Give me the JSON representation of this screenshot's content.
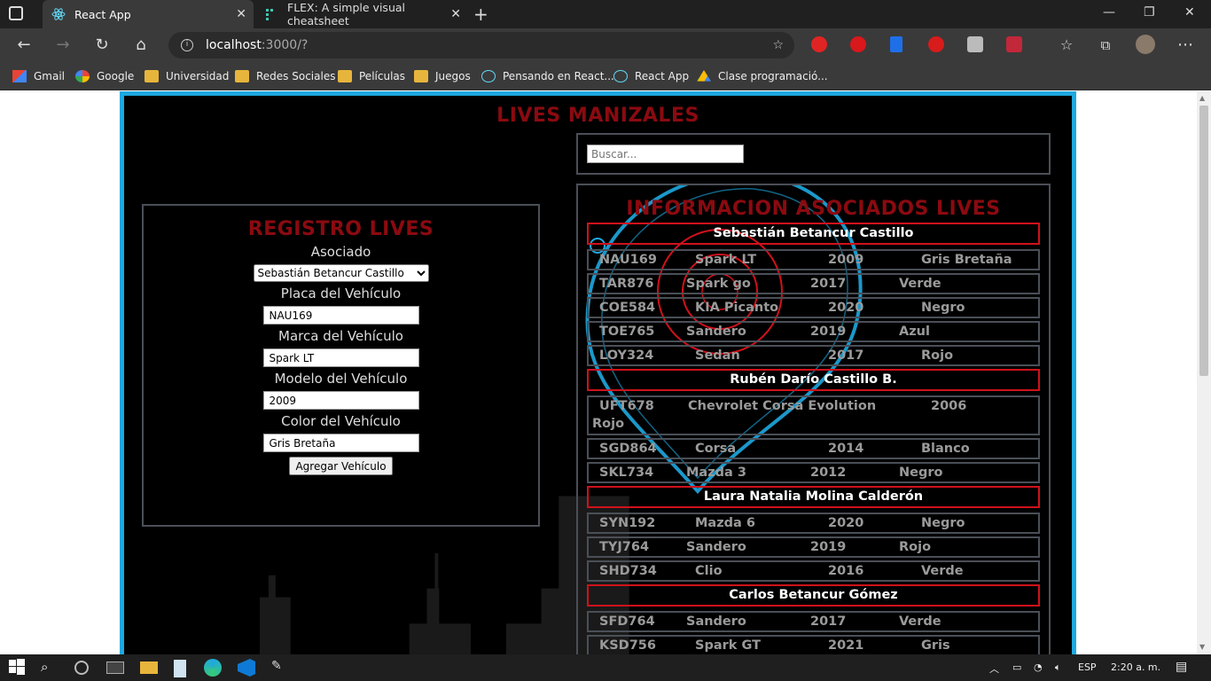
{
  "browser": {
    "tabs": [
      {
        "title": "React App",
        "active": true
      },
      {
        "title": "FLEX: A simple visual cheatsheet",
        "active": false
      }
    ],
    "address": {
      "host": "localhost",
      "rest": ":3000/?"
    },
    "bookmarks": [
      "Gmail",
      "Google",
      "Universidad",
      "Redes Sociales",
      "Películas",
      "Juegos",
      "Pensando en React...",
      "React App",
      "Clase programació..."
    ]
  },
  "page": {
    "title": "LIVES MANIZALES",
    "register": {
      "heading": "REGISTRO LIVES",
      "labels": {
        "asociado": "Asociado",
        "placa": "Placa del Vehículo",
        "marca": "Marca del Vehículo",
        "modelo": "Modelo del Vehículo",
        "color": "Color del Vehículo"
      },
      "values": {
        "asociado": "Sebastián Betancur Castillo",
        "placa": "NAU169",
        "marca": "Spark LT",
        "modelo": "2009",
        "color": "Gris Bretaña"
      },
      "button": "Agregar Vehículo"
    },
    "search": {
      "placeholder": "Buscar..."
    },
    "info": {
      "heading": "INFORMACION ASOCIADOS LIVES",
      "owners": [
        {
          "name": "Sebastián Betancur Castillo",
          "vehicles": [
            [
              "NAU169",
              "Spark LT",
              "2009",
              "Gris Bretaña"
            ],
            [
              "TAR876",
              "Spark go",
              "2017",
              "Verde"
            ],
            [
              "COE584",
              "KIA Picanto",
              "2020",
              "Negro"
            ],
            [
              "TOE765",
              "Sandero",
              "2019",
              "Azul"
            ],
            [
              "LOY324",
              "Sedan",
              "2017",
              "Rojo"
            ]
          ]
        },
        {
          "name": "Rubén Darío Castillo B.",
          "vehicles": [
            [
              "UFT678",
              "Chevrolet Corsa Evolution",
              "2006",
              "Rojo"
            ],
            [
              "SGD864",
              "Corsa",
              "2014",
              "Blanco"
            ],
            [
              "SKL734",
              "Mazda 3",
              "2012",
              "Negro"
            ]
          ]
        },
        {
          "name": "Laura Natalia Molina Calderón",
          "vehicles": [
            [
              "SYN192",
              "Mazda 6",
              "2020",
              "Negro"
            ],
            [
              "TYJ764",
              "Sandero",
              "2019",
              "Rojo"
            ],
            [
              "SHD734",
              "Clio",
              "2016",
              "Verde"
            ]
          ]
        },
        {
          "name": "Carlos Betancur Gómez",
          "vehicles": [
            [
              "SFD764",
              "Sandero",
              "2017",
              "Verde"
            ],
            [
              "KSD756",
              "Spark GT",
              "2021",
              "Gris"
            ]
          ]
        }
      ]
    }
  },
  "taskbar": {
    "lang": "ESP",
    "time": "2:20 a. m."
  }
}
